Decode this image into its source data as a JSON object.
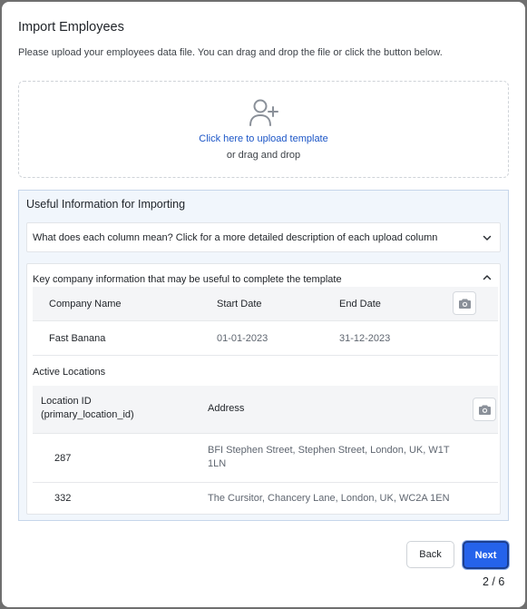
{
  "modal": {
    "title": "Import Employees",
    "description": "Please upload your employees data file. You can drag and drop the file or click the button below."
  },
  "upload": {
    "icon": "add-user-icon",
    "link_text": "Click here to upload template",
    "sub_text": "or drag and drop"
  },
  "info": {
    "title": "Useful Information for Importing",
    "column_help": {
      "label": "What does each column mean? Click for a more detailed description of each upload column",
      "icon": "chevron-down-icon"
    },
    "company_info": {
      "label": "Key company information that may be useful to complete the template",
      "icon": "chevron-up-icon",
      "headers": [
        "Company Name",
        "Start Date",
        "End Date"
      ],
      "rows": [
        [
          "Fast Banana",
          "01-01-2023",
          "31-12-2023"
        ]
      ],
      "camera_icon": "camera-icon"
    },
    "locations": {
      "title": "Active Locations",
      "headers": [
        "Location ID",
        "(primary_location_id)",
        "Address"
      ],
      "rows": [
        {
          "id": "287",
          "address_line1": "BFI Stephen Street, Stephen Street, London, UK, W1T",
          "address_line2": "1LN"
        },
        {
          "id": "332",
          "address_line1": "The Cursitor, Chancery Lane, London, UK, WC2A 1EN",
          "address_line2": ""
        }
      ],
      "camera_icon": "camera-icon"
    }
  },
  "footer": {
    "back_label": "Back",
    "next_label": "Next",
    "step": "2 / 6"
  },
  "colors": {
    "accent": "#2563eb",
    "link": "#1c56c7",
    "info_bg": "#f1f6fc",
    "info_border": "#c6d6ea"
  }
}
